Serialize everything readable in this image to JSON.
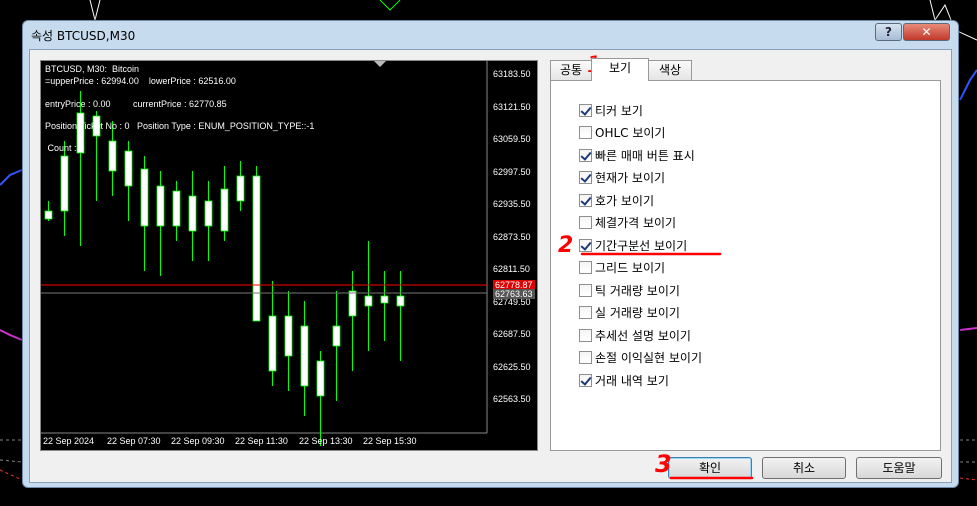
{
  "window": {
    "title": "속성 BTCUSD,M30",
    "help_glyph": "?",
    "close_glyph": "✕"
  },
  "preview": {
    "header_lines": [
      "BTCUSD, M30:  Bitcoin",
      "=upperPrice : 62994.00    lowerPrice : 62516.00",
      "entryPrice : 0.00         currentPrice : 62770.85",
      "Position Ticket No : 0   Position Type : ENUM_POSITION_TYPE::-1",
      " Count : 0"
    ],
    "price_labels": [
      "63183.50",
      "63121.50",
      "63059.50",
      "62997.50",
      "62935.50",
      "62873.50",
      "62811.50",
      "62749.50",
      "62687.50",
      "62625.50",
      "62563.50"
    ],
    "bid_tag": "62778.87",
    "ask_tag": "62763.63",
    "time_labels": [
      "22 Sep 2024",
      "22 Sep 07:30",
      "22 Sep 09:30",
      "22 Sep 11:30",
      "22 Sep 13:30",
      "22 Sep 15:30"
    ]
  },
  "tabs": [
    {
      "label": "공통"
    },
    {
      "label": "보기"
    },
    {
      "label": "색상"
    }
  ],
  "active_tab": "보기",
  "options": [
    {
      "label": "티커 보기",
      "checked": true
    },
    {
      "label": "OHLC 보이기",
      "checked": false
    },
    {
      "label": "빠른 매매 버튼 표시",
      "checked": true
    },
    {
      "label": "현재가 보이기",
      "checked": true
    },
    {
      "label": "호가 보이기",
      "checked": true
    },
    {
      "label": "체결가격 보이기",
      "checked": false
    },
    {
      "label": "기간구분선 보이기",
      "checked": true
    },
    {
      "label": "그리드 보이기",
      "checked": false
    },
    {
      "label": "틱 거래량 보이기",
      "checked": false
    },
    {
      "label": "실 거래량 보이기",
      "checked": false
    },
    {
      "label": "추세선 설명 보이기",
      "checked": false
    },
    {
      "label": "손절 이익실현 보이기",
      "checked": false
    },
    {
      "label": "거래 내역 보기",
      "checked": true
    }
  ],
  "buttons": {
    "ok": "확인",
    "cancel": "취소",
    "help": "도움말"
  },
  "annotations": [
    "1",
    "2",
    "3"
  ],
  "colors": {
    "candle_wick": "#00ff00",
    "candle_bull": "#ffffff",
    "bid_line": "#ff0000",
    "annotation": "#ff0000"
  }
}
